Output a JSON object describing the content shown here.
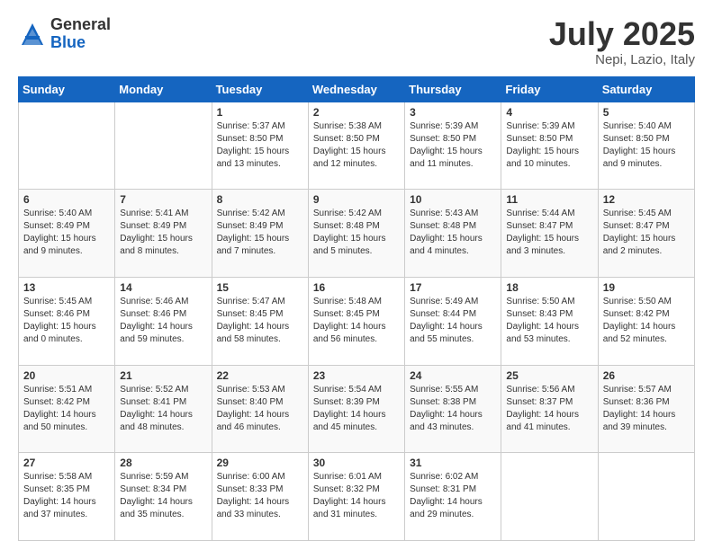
{
  "header": {
    "logo_general": "General",
    "logo_blue": "Blue",
    "month_title": "July 2025",
    "location": "Nepi, Lazio, Italy"
  },
  "weekdays": [
    "Sunday",
    "Monday",
    "Tuesday",
    "Wednesday",
    "Thursday",
    "Friday",
    "Saturday"
  ],
  "weeks": [
    [
      {
        "day": "",
        "info": ""
      },
      {
        "day": "",
        "info": ""
      },
      {
        "day": "1",
        "info": "Sunrise: 5:37 AM\nSunset: 8:50 PM\nDaylight: 15 hours\nand 13 minutes."
      },
      {
        "day": "2",
        "info": "Sunrise: 5:38 AM\nSunset: 8:50 PM\nDaylight: 15 hours\nand 12 minutes."
      },
      {
        "day": "3",
        "info": "Sunrise: 5:39 AM\nSunset: 8:50 PM\nDaylight: 15 hours\nand 11 minutes."
      },
      {
        "day": "4",
        "info": "Sunrise: 5:39 AM\nSunset: 8:50 PM\nDaylight: 15 hours\nand 10 minutes."
      },
      {
        "day": "5",
        "info": "Sunrise: 5:40 AM\nSunset: 8:50 PM\nDaylight: 15 hours\nand 9 minutes."
      }
    ],
    [
      {
        "day": "6",
        "info": "Sunrise: 5:40 AM\nSunset: 8:49 PM\nDaylight: 15 hours\nand 9 minutes."
      },
      {
        "day": "7",
        "info": "Sunrise: 5:41 AM\nSunset: 8:49 PM\nDaylight: 15 hours\nand 8 minutes."
      },
      {
        "day": "8",
        "info": "Sunrise: 5:42 AM\nSunset: 8:49 PM\nDaylight: 15 hours\nand 7 minutes."
      },
      {
        "day": "9",
        "info": "Sunrise: 5:42 AM\nSunset: 8:48 PM\nDaylight: 15 hours\nand 5 minutes."
      },
      {
        "day": "10",
        "info": "Sunrise: 5:43 AM\nSunset: 8:48 PM\nDaylight: 15 hours\nand 4 minutes."
      },
      {
        "day": "11",
        "info": "Sunrise: 5:44 AM\nSunset: 8:47 PM\nDaylight: 15 hours\nand 3 minutes."
      },
      {
        "day": "12",
        "info": "Sunrise: 5:45 AM\nSunset: 8:47 PM\nDaylight: 15 hours\nand 2 minutes."
      }
    ],
    [
      {
        "day": "13",
        "info": "Sunrise: 5:45 AM\nSunset: 8:46 PM\nDaylight: 15 hours\nand 0 minutes."
      },
      {
        "day": "14",
        "info": "Sunrise: 5:46 AM\nSunset: 8:46 PM\nDaylight: 14 hours\nand 59 minutes."
      },
      {
        "day": "15",
        "info": "Sunrise: 5:47 AM\nSunset: 8:45 PM\nDaylight: 14 hours\nand 58 minutes."
      },
      {
        "day": "16",
        "info": "Sunrise: 5:48 AM\nSunset: 8:45 PM\nDaylight: 14 hours\nand 56 minutes."
      },
      {
        "day": "17",
        "info": "Sunrise: 5:49 AM\nSunset: 8:44 PM\nDaylight: 14 hours\nand 55 minutes."
      },
      {
        "day": "18",
        "info": "Sunrise: 5:50 AM\nSunset: 8:43 PM\nDaylight: 14 hours\nand 53 minutes."
      },
      {
        "day": "19",
        "info": "Sunrise: 5:50 AM\nSunset: 8:42 PM\nDaylight: 14 hours\nand 52 minutes."
      }
    ],
    [
      {
        "day": "20",
        "info": "Sunrise: 5:51 AM\nSunset: 8:42 PM\nDaylight: 14 hours\nand 50 minutes."
      },
      {
        "day": "21",
        "info": "Sunrise: 5:52 AM\nSunset: 8:41 PM\nDaylight: 14 hours\nand 48 minutes."
      },
      {
        "day": "22",
        "info": "Sunrise: 5:53 AM\nSunset: 8:40 PM\nDaylight: 14 hours\nand 46 minutes."
      },
      {
        "day": "23",
        "info": "Sunrise: 5:54 AM\nSunset: 8:39 PM\nDaylight: 14 hours\nand 45 minutes."
      },
      {
        "day": "24",
        "info": "Sunrise: 5:55 AM\nSunset: 8:38 PM\nDaylight: 14 hours\nand 43 minutes."
      },
      {
        "day": "25",
        "info": "Sunrise: 5:56 AM\nSunset: 8:37 PM\nDaylight: 14 hours\nand 41 minutes."
      },
      {
        "day": "26",
        "info": "Sunrise: 5:57 AM\nSunset: 8:36 PM\nDaylight: 14 hours\nand 39 minutes."
      }
    ],
    [
      {
        "day": "27",
        "info": "Sunrise: 5:58 AM\nSunset: 8:35 PM\nDaylight: 14 hours\nand 37 minutes."
      },
      {
        "day": "28",
        "info": "Sunrise: 5:59 AM\nSunset: 8:34 PM\nDaylight: 14 hours\nand 35 minutes."
      },
      {
        "day": "29",
        "info": "Sunrise: 6:00 AM\nSunset: 8:33 PM\nDaylight: 14 hours\nand 33 minutes."
      },
      {
        "day": "30",
        "info": "Sunrise: 6:01 AM\nSunset: 8:32 PM\nDaylight: 14 hours\nand 31 minutes."
      },
      {
        "day": "31",
        "info": "Sunrise: 6:02 AM\nSunset: 8:31 PM\nDaylight: 14 hours\nand 29 minutes."
      },
      {
        "day": "",
        "info": ""
      },
      {
        "day": "",
        "info": ""
      }
    ]
  ]
}
